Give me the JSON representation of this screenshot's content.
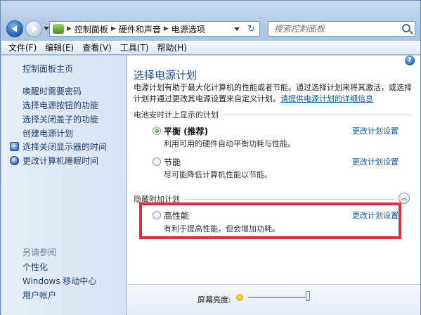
{
  "address": {
    "crumbs": [
      "控制面板",
      "硬件和声音",
      "电源选项"
    ]
  },
  "search": {
    "placeholder": "搜索控制面板"
  },
  "menu": {
    "file": "文件(F)",
    "edit": "编辑(E)",
    "view": "查看(V)",
    "tools": "工具(T)",
    "help": "帮助(H)"
  },
  "sidebar": {
    "home": "控制面板主页",
    "links": [
      "唤醒时需要密码",
      "选择电源按钮的功能",
      "选择关闭盖子的功能",
      "创建电源计划"
    ],
    "icon_links": [
      {
        "label": "选择关闭显示器的时间",
        "icon": "monitor-icon"
      },
      {
        "label": "更改计算机睡眠时间",
        "icon": "sleep-icon"
      }
    ],
    "see_also": "另请参阅",
    "see_also_links": [
      "个性化",
      "Windows 移动中心",
      "用户帐户"
    ]
  },
  "main": {
    "title": "选择电源计划",
    "desc_text": "电源计划有助于最大化计算机的性能或者节能。通过选择计划来将其激活，或选择计划并通过更改其电源设置来自定义计划。",
    "desc_link": "请提供电源计划的详细信息",
    "battery_section": "电池安时计上显示的计划",
    "plans": [
      {
        "name": "平衡 (推荐)",
        "desc": "利用可用的硬件自动平衡功耗与性能。",
        "link": "更改计划设置",
        "checked": true
      },
      {
        "name": "节能",
        "desc": "尽可能降低计算机性能以节能。",
        "link": "更改计划设置",
        "checked": false
      }
    ],
    "hidden_section": "隐藏附加计划",
    "hidden_plan": {
      "name": "高性能",
      "desc": "有利于提高性能，但会增加功耗。",
      "link": "更改计划设置",
      "checked": false
    },
    "brightness_label": "屏幕亮度:"
  },
  "colors": {
    "accent": "#1e4f8f",
    "link": "#0c5aa8",
    "highlight": "#e0303a"
  }
}
